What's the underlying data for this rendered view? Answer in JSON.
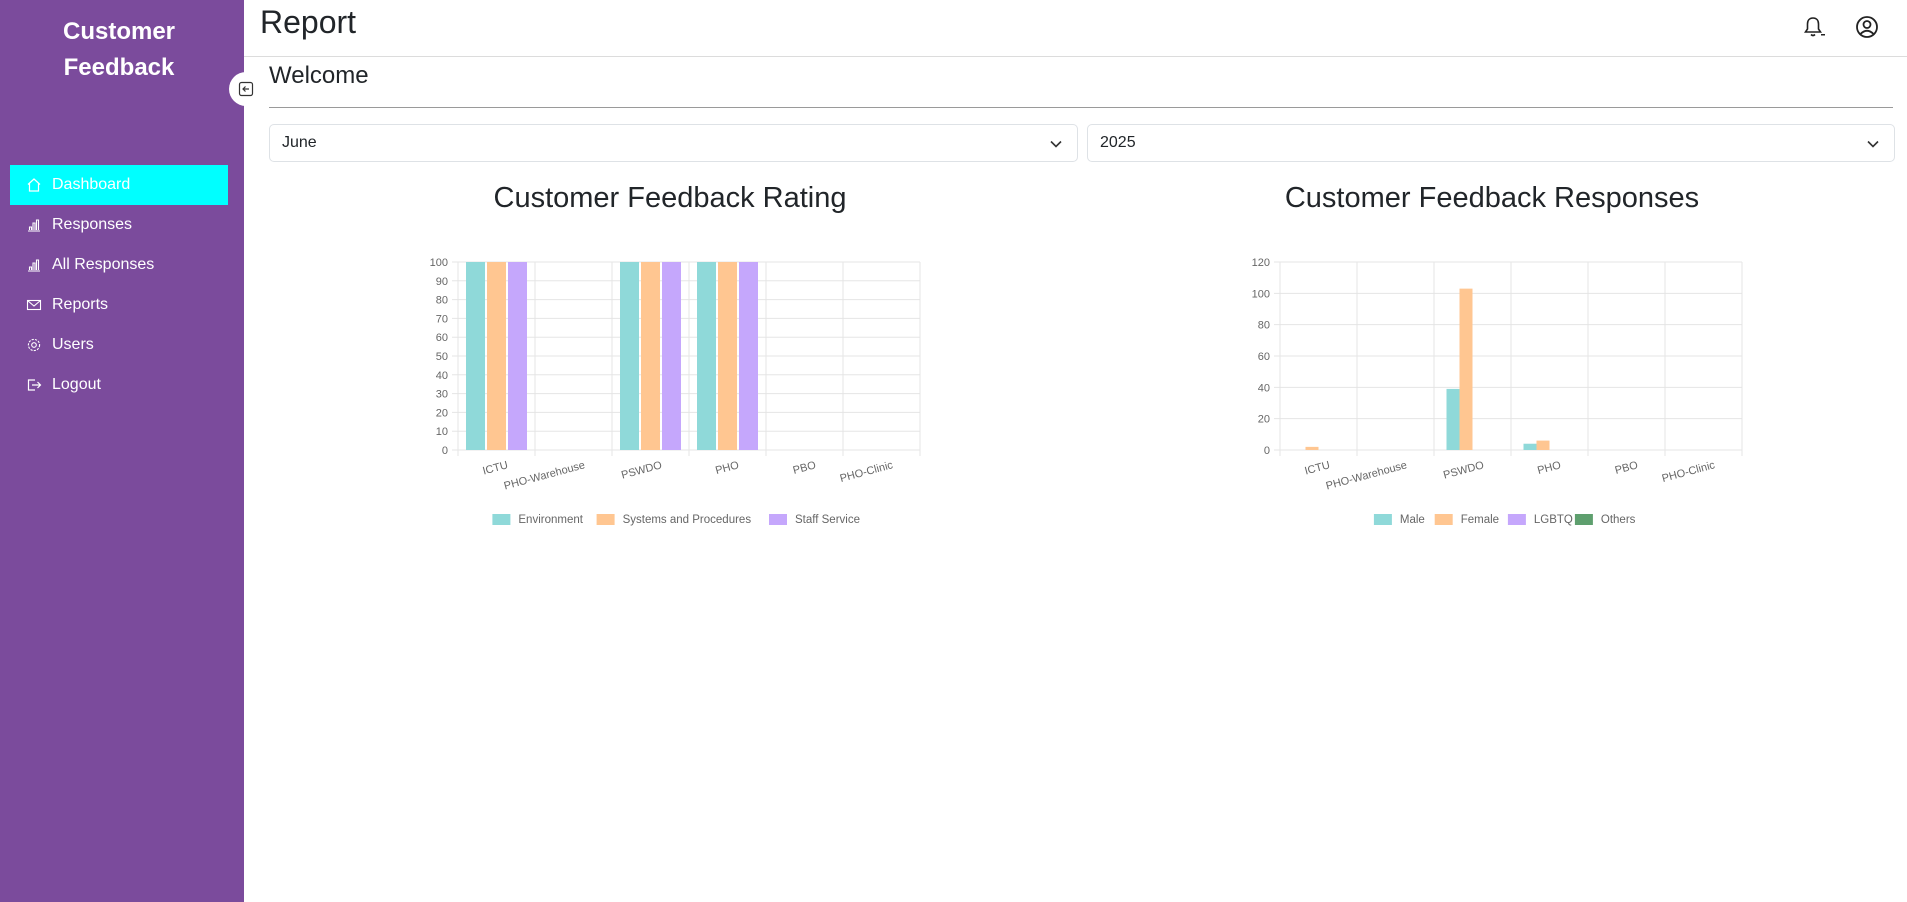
{
  "sidebar": {
    "brand": "Customer Feedback",
    "items": [
      {
        "label": "Dashboard",
        "icon": "home-icon",
        "active": true
      },
      {
        "label": "Responses",
        "icon": "bar-chart-icon",
        "active": false
      },
      {
        "label": "All Responses",
        "icon": "bar-chart-icon",
        "active": false
      },
      {
        "label": "Reports",
        "icon": "envelope-icon",
        "active": false
      },
      {
        "label": "Users",
        "icon": "gear-icon",
        "active": false
      },
      {
        "label": "Logout",
        "icon": "logout-icon",
        "active": false
      }
    ]
  },
  "header": {
    "title": "Report"
  },
  "main": {
    "welcome": "Welcome",
    "month_select": {
      "value": "June"
    },
    "year_select": {
      "value": "2025"
    }
  },
  "colors": {
    "sidebar_bg": "#7b4b9c",
    "active_item": "#00ffff",
    "series_teal": "#8fd9d9",
    "series_orange": "#ffc691",
    "series_purple": "#c5a7fc",
    "series_green": "#5e9f6e"
  },
  "chart_data": [
    {
      "type": "bar",
      "title": "Customer Feedback Rating",
      "categories": [
        "ICTU",
        "PHO-Warehouse",
        "PSWDO",
        "PHO",
        "PBO",
        "PHO-Clinic"
      ],
      "ylim": [
        0,
        100
      ],
      "yticks": [
        0,
        10,
        20,
        30,
        40,
        50,
        60,
        70,
        80,
        90,
        100
      ],
      "grid": true,
      "legend_position": "bottom",
      "series": [
        {
          "name": "Environment",
          "color": "#8fd9d9",
          "values": [
            100,
            0,
            100,
            100,
            0,
            0
          ]
        },
        {
          "name": "Systems and Procedures",
          "color": "#ffc691",
          "values": [
            100,
            0,
            100,
            100,
            0,
            0
          ]
        },
        {
          "name": "Staff Service",
          "color": "#c5a7fc",
          "values": [
            100,
            0,
            100,
            100,
            0,
            0
          ]
        }
      ]
    },
    {
      "type": "bar",
      "title": "Customer Feedback Responses",
      "categories": [
        "ICTU",
        "PHO-Warehouse",
        "PSWDO",
        "PHO",
        "PBO",
        "PHO-Clinic"
      ],
      "ylim": [
        0,
        120
      ],
      "yticks": [
        0,
        20,
        40,
        60,
        80,
        100,
        120
      ],
      "grid": true,
      "legend_position": "bottom",
      "series": [
        {
          "name": "Male",
          "color": "#8fd9d9",
          "values": [
            0,
            0,
            39,
            4,
            0,
            0
          ]
        },
        {
          "name": "Female",
          "color": "#ffc691",
          "values": [
            2,
            0,
            103,
            6,
            0,
            0
          ]
        },
        {
          "name": "LGBTQ",
          "color": "#c5a7fc",
          "values": [
            0,
            0,
            0,
            0,
            0,
            0
          ]
        },
        {
          "name": "Others",
          "color": "#5e9f6e",
          "values": [
            0,
            0,
            0,
            0,
            0,
            0
          ]
        }
      ]
    }
  ]
}
